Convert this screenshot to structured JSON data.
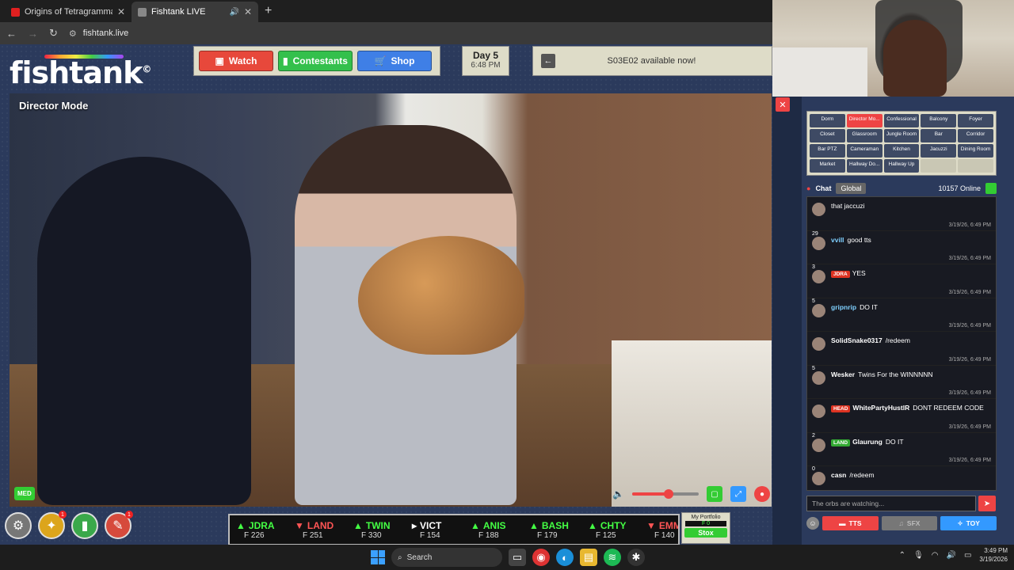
{
  "browser": {
    "tabs": [
      {
        "title": "Origins of Tetragrammaton | Jo",
        "favicon_color": "#e02020"
      },
      {
        "title": "Fishtank LIVE",
        "favicon_color": "#888888",
        "active": true
      }
    ],
    "new_tab": "+",
    "url": "fishtank.live"
  },
  "site": {
    "logo": "fishtank",
    "logo_mark": "©",
    "nav": {
      "watch": "Watch",
      "contestants": "Contestants",
      "shop": "Shop"
    },
    "day": {
      "label": "Day 5",
      "time": "6:48 PM"
    },
    "episode_notice": "S03E02 available now!",
    "video": {
      "mode_label": "Director Mode",
      "quality": "MED",
      "volume_fraction": 0.55
    }
  },
  "bottom": {
    "circles": [
      {
        "name": "settings",
        "icon": "⚙",
        "badge": ""
      },
      {
        "name": "inventory",
        "icon": "✦",
        "badge": "1"
      },
      {
        "name": "contestant",
        "icon": "▮",
        "badge": ""
      },
      {
        "name": "tools",
        "icon": "✎",
        "badge": "1"
      }
    ],
    "ticker": [
      {
        "symbol": "JDRA",
        "price": "F 226",
        "dir": "up"
      },
      {
        "symbol": "LAND",
        "price": "F 251",
        "dir": "down"
      },
      {
        "symbol": "TWIN",
        "price": "F 330",
        "dir": "up"
      },
      {
        "symbol": "VICT",
        "price": "F 154",
        "dir": "flat"
      },
      {
        "symbol": "ANIS",
        "price": "F 188",
        "dir": "up"
      },
      {
        "symbol": "BASH",
        "price": "F 179",
        "dir": "up"
      },
      {
        "symbol": "CHTY",
        "price": "F 125",
        "dir": "up"
      },
      {
        "symbol": "EMM",
        "price": "F 140",
        "dir": "down"
      }
    ],
    "portfolio": {
      "label": "My Portfolio",
      "value": "F 0",
      "button": "Stox"
    }
  },
  "side": {
    "cameras": [
      "Dorm",
      "Director Mo...",
      "Confessional",
      "Balcony",
      "Foyer",
      "Closet",
      "Glassroom",
      "Jungle Room",
      "Bar",
      "Corridor",
      "Bar PTZ",
      "Cameraman",
      "Kitchen",
      "Jacuzzi",
      "Dining Room",
      "Market",
      "Hallway Do...",
      "Hallway Up",
      "",
      ""
    ],
    "active_camera": 1,
    "chat": {
      "label": "Chat",
      "scope": "Global",
      "online": "10157 Online",
      "messages": [
        {
          "level": "",
          "user": "",
          "tag": "",
          "tag_color": "",
          "user_color": "#ffffff",
          "text": "that jaccuzi",
          "time": "3/19/26, 6:49 PM"
        },
        {
          "level": "29",
          "user": "vvill",
          "tag": "",
          "tag_color": "",
          "user_color": "#7fd0ff",
          "text": "good tts",
          "time": "3/19/26, 6:49 PM"
        },
        {
          "level": "3",
          "user": "",
          "tag": "JDRA",
          "tag_color": "#d32",
          "user_color": "#ff3333",
          "text": "YES",
          "time": "3/19/26, 6:49 PM"
        },
        {
          "level": "5",
          "user": "gripnrip",
          "tag": "",
          "tag_color": "",
          "user_color": "#7fd0ff",
          "text": "DO IT",
          "time": "3/19/26, 6:49 PM"
        },
        {
          "level": "",
          "user": "SolidSnake0317",
          "tag": "",
          "tag_color": "",
          "user_color": "#ffffff",
          "text": "/redeem",
          "time": "3/19/26, 6:49 PM"
        },
        {
          "level": "5",
          "user": "Wesker",
          "tag": "",
          "tag_color": "",
          "user_color": "#ffffff",
          "text": "Twins For the WINNNNN",
          "time": "3/19/26, 6:49 PM"
        },
        {
          "level": "",
          "user": "WhitePartyHustlR",
          "tag": "HEAD",
          "tag_color": "#d32",
          "user_color": "#ffffff",
          "text": "DONT REDEEM CODE",
          "time": "3/19/26, 6:49 PM"
        },
        {
          "level": "2",
          "user": "Glaurung",
          "tag": "LAND",
          "tag_color": "#3a3",
          "user_color": "#ffffff",
          "text": "DO IT",
          "time": "3/19/26, 6:49 PM"
        },
        {
          "level": "0",
          "user": "casn",
          "tag": "",
          "tag_color": "",
          "user_color": "#ffffff",
          "text": "/redeem",
          "time": "3/19/26, 6:49 PM"
        }
      ],
      "input_placeholder": "The orbs are watching..."
    },
    "buttons": {
      "tts": "TTS",
      "sfx": "SFX",
      "toy": "TOY"
    }
  },
  "taskbar": {
    "search": "Search",
    "time": "3:49 PM",
    "date": "3/19/2026"
  }
}
